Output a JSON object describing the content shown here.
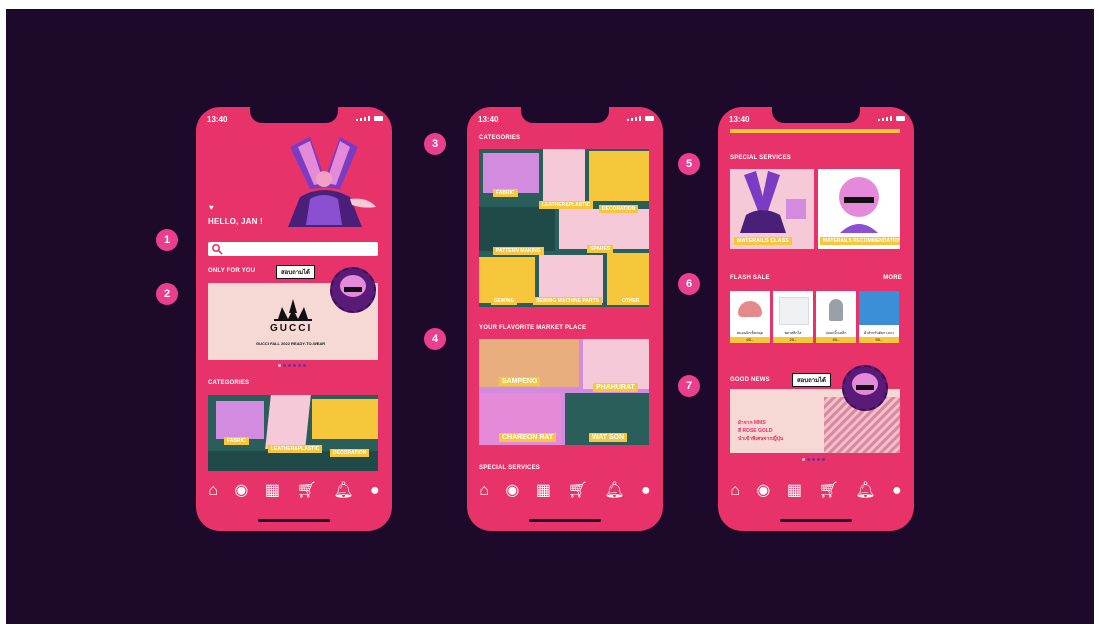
{
  "phone1": {
    "time": "13:40",
    "greeting": "HELLO, JAN !",
    "only_for_you": "ONLY FOR YOU",
    "banner_tag": "สอบถามได้",
    "banner_brand": "GUCCI",
    "banner_caption": "GUCCI FALL 2022 READY-TO-WEAR",
    "categories_title": "CATEGORIES",
    "cat_labels": [
      "FABRIC",
      "LEATHER&PLASTIC",
      "DECORATION"
    ]
  },
  "phone2": {
    "time": "13:40",
    "categories_title": "CATEGORIES",
    "categories": [
      "FABRIC",
      "LEATHER&PLASTIC",
      "DECORATION",
      "PATTERN MAKING",
      "SPARES",
      "SEWING",
      "SEWING MACHINE PARTS",
      "OTHER"
    ],
    "market_title": "YOUR FLAVORITE MARKET PLACE",
    "markets": [
      "SAMPENG",
      "PHAHURAT",
      "CHAREON RAT",
      "WAT SON"
    ],
    "special_title": "SPECIAL SERVICES"
  },
  "phone3": {
    "time": "13:40",
    "special_title": "SPECIAL SERVICES",
    "services": [
      "MATERAILS CLASS",
      "MATERAILS RECOMMENDATION"
    ],
    "flash_title": "FLASH SALE",
    "flash_more": "MORE",
    "flash_items": [
      {
        "name": "หมอนปักเข็มหมุด",
        "price": "60.-"
      },
      {
        "name": "พลาสติกใส",
        "price": "20.-"
      },
      {
        "name": "ปลอกนิ้วเหล็ก",
        "price": "40.-"
      },
      {
        "name": "ผ้าสำหรับตัดกางเกง",
        "price": "50.-"
      }
    ],
    "news_title": "GOOD NEWS",
    "news_tag": "สอบถามได้",
    "news_text": [
      "ผ้าจาก MMS",
      "สี ROSE GOLD",
      "นำเข้าพิเศษจากญี่ปุ่น"
    ]
  },
  "annotations": [
    "1",
    "2",
    "3",
    "4",
    "5",
    "6",
    "7"
  ],
  "nav_icons": [
    "home-icon",
    "spool-icon",
    "grid-icon",
    "cart-icon",
    "bell-icon",
    "user-icon"
  ],
  "colors": {
    "background": "#1d0a2a",
    "phone": "#e8336a",
    "accent_yellow": "#f6c63b",
    "bubble": "#ea3e8f",
    "teal": "#2a5e5a"
  }
}
